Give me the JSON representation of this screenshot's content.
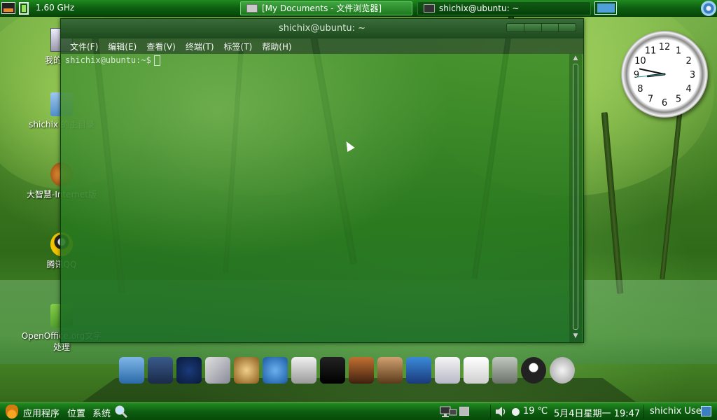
{
  "top_panel": {
    "cpu_freq": "1.60 GHz",
    "tasks": [
      {
        "label": "[My Documents - 文件浏览器]",
        "active": true
      },
      {
        "label": "shichix@ubuntu: ~",
        "active": false
      }
    ]
  },
  "desktop_icons": [
    {
      "name": "computer",
      "label": "我的电脑"
    },
    {
      "name": "home-folder",
      "label": "shichix 的主目录"
    },
    {
      "name": "dazhihui",
      "label": "大智慧-Internet版"
    },
    {
      "name": "qq",
      "label": "腾讯QQ"
    },
    {
      "name": "openoffice",
      "label": "OpenOffice.org文字处理"
    }
  ],
  "terminal": {
    "title": "shichix@ubuntu: ~",
    "menu": [
      "文件(F)",
      "编辑(E)",
      "查看(V)",
      "终端(T)",
      "标签(T)",
      "帮助(H)"
    ],
    "prompt": "shichix@ubuntu:~$"
  },
  "clock": {
    "hour": 8,
    "minute": 47,
    "second": 44
  },
  "dock": {
    "icons": [
      "finder-icon",
      "widgets-icon",
      "system-monitor-icon",
      "media-icon",
      "compass-icon",
      "browser-icon",
      "mail-envelope-icon",
      "terminal-icon",
      "photo-icon",
      "image-viewer-icon",
      "movie-icon",
      "mail-icon",
      "text-editor-icon",
      "trash-icon",
      "penguin-icon",
      "disk-icon"
    ]
  },
  "bottom_panel": {
    "applications": "应用程序",
    "places": "位置",
    "system": "系统",
    "temperature": "19 ℃",
    "datetime": "5月4日星期一 19:47",
    "user": "shichix User"
  },
  "colors": {
    "panel_green": "#0d5e10",
    "accent_blue": "#3a7fc0"
  }
}
